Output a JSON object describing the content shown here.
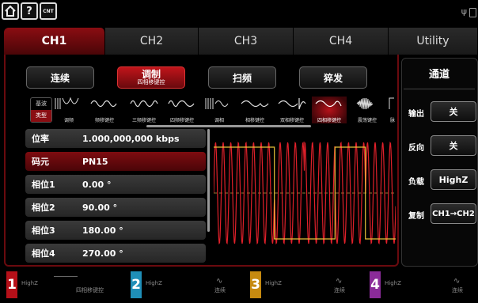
{
  "top_icons": [
    {
      "name": "home-icon"
    },
    {
      "name": "help-icon",
      "text": "?"
    },
    {
      "name": "counter-icon",
      "text": "CNT"
    }
  ],
  "status": {
    "usb_icon": "ψ"
  },
  "tabs": [
    {
      "label": "CH1"
    },
    {
      "label": "CH2"
    },
    {
      "label": "CH3"
    },
    {
      "label": "CH4"
    },
    {
      "label": "Utility"
    }
  ],
  "modes": [
    {
      "label": "连续"
    },
    {
      "label": "调制",
      "sub": "四相移键控"
    },
    {
      "label": "扫频"
    },
    {
      "label": "猝发"
    }
  ],
  "mod_types": {
    "side_top": "基波",
    "side_bottom": "类型",
    "items": [
      "调频",
      "频移键控",
      "三频移键控",
      "四频移键控",
      "调相",
      "相移键控",
      "双相移键控",
      "四相移键控",
      "震荡键控",
      "脉"
    ]
  },
  "params": [
    {
      "label": "位率",
      "value": "1.000,000,000 kbps"
    },
    {
      "label": "码元",
      "value": "PN15"
    },
    {
      "label": "相位1",
      "value": "0.00 °"
    },
    {
      "label": "相位2",
      "value": "90.00 °"
    },
    {
      "label": "相位3",
      "value": "180.00 °"
    },
    {
      "label": "相位4",
      "value": "270.00 °"
    }
  ],
  "right_panel": {
    "title": "通道",
    "rows": [
      {
        "label": "输出",
        "value": "关"
      },
      {
        "label": "反向",
        "value": "关"
      },
      {
        "label": "负载",
        "value": "HighZ"
      },
      {
        "label": "复制",
        "value": "CH1→CH2"
      }
    ]
  },
  "bottom": [
    {
      "num": "1",
      "load": "HighZ",
      "mode": "四相移键控",
      "color": "#b51019"
    },
    {
      "num": "2",
      "load": "HighZ",
      "mode": "连续",
      "color": "#1f8fb8"
    },
    {
      "num": "3",
      "load": "HighZ",
      "mode": "连续",
      "color": "#c68a10"
    },
    {
      "num": "4",
      "load": "HighZ",
      "mode": "连续",
      "color": "#8b2b99"
    }
  ],
  "colors": {
    "accent": "#b5121a",
    "wave_yellow": "#e8c23a",
    "wave_red": "#e0202a"
  }
}
